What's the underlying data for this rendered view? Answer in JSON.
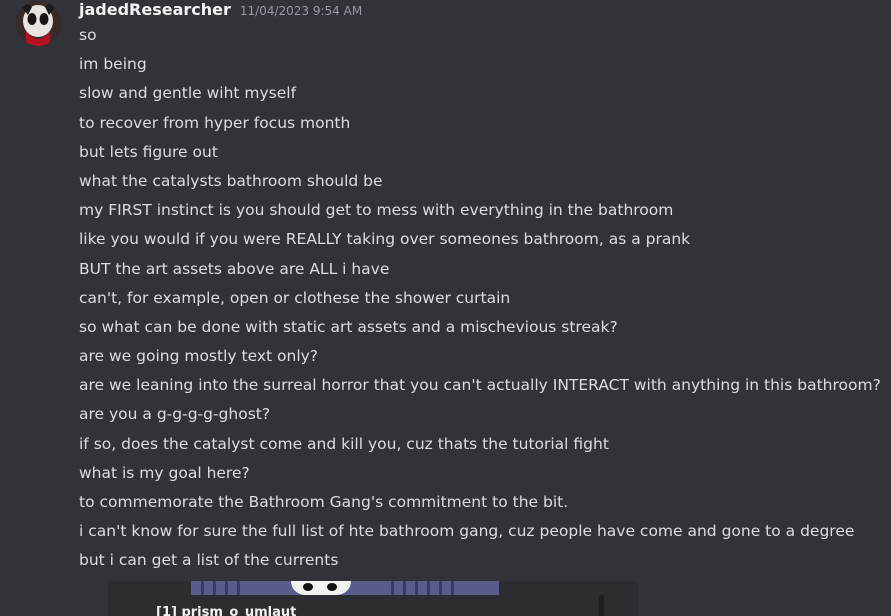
{
  "message": {
    "author": "jadedResearcher",
    "timestamp": "11/04/2023 9:54 AM",
    "lines": [
      "so",
      "im being",
      "slow and gentle wiht myself",
      "to recover from hyper focus month",
      "but lets figure out",
      "what the catalysts bathroom should be",
      "my FIRST instinct is you should get to mess with everything in the bathroom",
      "like you would if you were REALLY taking over someones bathroom, as a prank",
      "BUT the art assets above are ALL i have",
      "can't, for example, open or clothese the shower curtain",
      "so what can be done with static art assets and a mischevious streak?",
      "are we going mostly text only?",
      "are we leaning into the surreal horror that you can't actually INTERACT with anything in this bathroom?",
      "are you a g-g-g-g-ghost?",
      "if so, does the catalyst come and kill you, cuz thats the tutorial fight",
      "what is my goal here?",
      "to commemorate the Bathroom Gang's commitment to the bit.",
      "i can't know for sure the full list of hte bathroom gang, cuz people have come and gone to a degree",
      "but i can get a list of the currents"
    ]
  },
  "embed": {
    "title": "[1] prism_o_umlaut"
  },
  "colors": {
    "background": "#313338",
    "username": "#f2f3f5",
    "timestamp": "#949ba4",
    "text": "#dbdee1",
    "embed_bg": "#2b2d31"
  },
  "icons": {
    "avatar": "avatar-skull-image"
  }
}
